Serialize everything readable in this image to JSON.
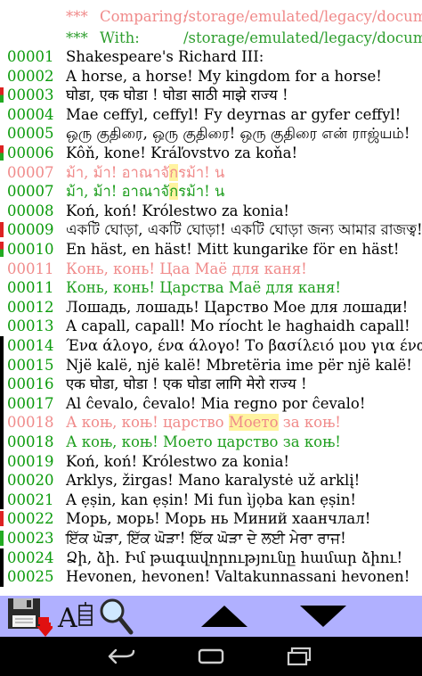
{
  "header": {
    "comparing": {
      "stars": "***",
      "label": "Comparing:",
      "path": "/storage/emulated/legacy/documents"
    },
    "with": {
      "stars": "***",
      "label": "With:",
      "path": "/storage/emulated/legacy/documents"
    }
  },
  "colors": {
    "match_green": "#0a9a0a",
    "deleted_pink": "#f08a8a",
    "inserted_green": "#1e9e1e",
    "highlight": "#fff3a0",
    "marker_red": "#dd2222",
    "marker_green": "#22aa22",
    "toolbar_bg": "#b0b0ff",
    "navbar_bg": "#000000"
  },
  "lines": [
    {
      "num": "00001",
      "text": "Shakespeare's Richard III:",
      "state": "same",
      "marker": ""
    },
    {
      "num": "00002",
      "text": "A horse, a horse! My kingdom for a horse!",
      "state": "same",
      "marker": ""
    },
    {
      "num": "00003",
      "text": "घोडा, एक घोडा ! घोडा साठी माझे राज्य !",
      "state": "same",
      "marker": "red-green"
    },
    {
      "num": "00004",
      "text": "Mae ceffyl, ceffyl! Fy deyrnas ar gyfer ceffyl!",
      "state": "same",
      "marker": ""
    },
    {
      "num": "00005",
      "text": "ஒரு குதிரை, ஒரு குதிரை! ஒரு குதிரை என் ராஜ்யம்!",
      "state": "same",
      "marker": ""
    },
    {
      "num": "00006",
      "text": "Kôň, kone! Kráľovstvo za koňa!",
      "state": "same",
      "marker": "red-green"
    },
    {
      "num": "00007",
      "text": "ม้า, ม้า! อาณาจักรม้า! น",
      "state": "deleted",
      "marker": ""
    },
    {
      "num": "00007",
      "text": "ม้า, ม้า! อาณาจักรม้า! น",
      "state": "inserted",
      "marker": ""
    },
    {
      "num": "00008",
      "text": "Koń, koń! Królestwo za konia!",
      "state": "same",
      "marker": ""
    },
    {
      "num": "00009",
      "text": "একটি ঘোড়া, একটি ঘোড়া! একটি ঘোড়া জন্য আমার রাজত্ব!",
      "state": "same",
      "marker": "red"
    },
    {
      "num": "00010",
      "text": "En häst, en häst! Mitt kungarike för en häst!",
      "state": "same",
      "marker": "red-green"
    },
    {
      "num": "00011",
      "text": "Конь, конь! Цаа Маё для каня!",
      "state": "deleted",
      "marker": ""
    },
    {
      "num": "00011",
      "text": "Конь, конь! Царства Маё для каня!",
      "state": "inserted",
      "marker": ""
    },
    {
      "num": "00012",
      "text": "Лошадь, лошадь! Царство Мое для лошади!",
      "state": "same",
      "marker": ""
    },
    {
      "num": "00013",
      "text": "A capall, capall! Mo ríocht le haghaidh capall!",
      "state": "same",
      "marker": ""
    },
    {
      "num": "00014",
      "text": "Ένα άλογο, ένα άλογο! Το βασίλειό μου για ένα άλογο!",
      "state": "same",
      "marker": "black"
    },
    {
      "num": "00015",
      "text": "Një kalë, një kalë! Mbretëria ime për një kalë!",
      "state": "same",
      "marker": "black"
    },
    {
      "num": "00016",
      "text": "एक घोडा, घोडा ! एक घोडा लागि मेरो राज्य !",
      "state": "same",
      "marker": "black"
    },
    {
      "num": "00017",
      "text": "Al ĉevalo, ĉevalo! Mia regno por ĉevalo!",
      "state": "same",
      "marker": "black"
    },
    {
      "num": "00018",
      "text": "А коњ, коњ! царство Моето за коњ!",
      "state": "deleted",
      "marker": "black"
    },
    {
      "num": "00018",
      "text": "А коњ, коњ! Моето царство за коњ!",
      "state": "inserted",
      "marker": "black"
    },
    {
      "num": "00019",
      "text": "Koń, koń! Królestwo za konia!",
      "state": "same",
      "marker": "black"
    },
    {
      "num": "00020",
      "text": "Arklys, žirgas! Mano karalystė už arklį!",
      "state": "same",
      "marker": "black"
    },
    {
      "num": "00021",
      "text": "A ẹṣin, kan ẹṣin! Mi fun ìjọba kan ẹṣin!",
      "state": "same",
      "marker": "black"
    },
    {
      "num": "00022",
      "text": "Морь, морь! Морь нь Миний хаанчлал!",
      "state": "same",
      "marker": "red"
    },
    {
      "num": "00023",
      "text": "ਇੱਕ ਘੋੜਾ, ਇੱਕ ਘੋੜਾ! ਇੱਕ ਘੋੜਾ ਦੇ ਲਈ ਮੇਰਾ ਰਾਜ!",
      "state": "same",
      "marker": "green"
    },
    {
      "num": "00024",
      "text": "Ձի, ձի. Իմ թագավորությունը համար ձիու!",
      "state": "same",
      "marker": "black"
    },
    {
      "num": "00025",
      "text": "Hevonen, hevonen! Valtakunnassani hevonen!",
      "state": "same",
      "marker": "black"
    }
  ],
  "highlights": {
    "7a": "ก",
    "7b": "ก",
    "11a": "Цаа",
    "11b": "Царства",
    "18a": "Моето",
    "18b": "Моето"
  },
  "toolbar": {
    "save_icon": "floppy-save-icon",
    "font_icon": "font-size-icon",
    "font_label": "A",
    "search_icon": "magnifier-icon",
    "up_icon": "triangle-up-icon",
    "down_icon": "triangle-down-icon"
  },
  "navbar": {
    "back_icon": "back-arrow-icon",
    "home_icon": "home-icon",
    "recents_icon": "recents-icon"
  }
}
